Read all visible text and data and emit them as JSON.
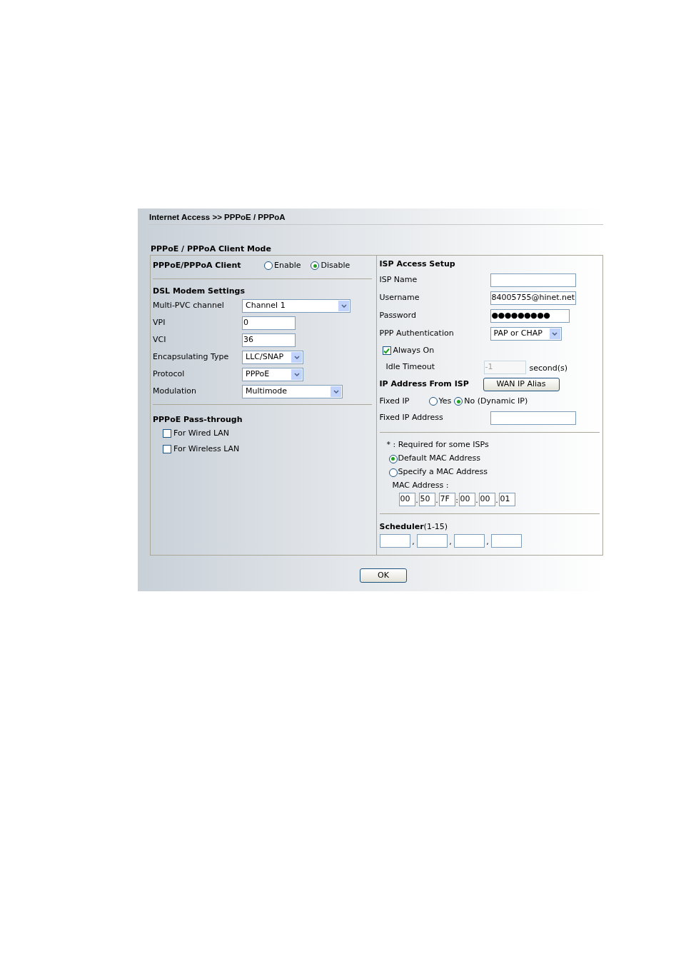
{
  "breadcrumb": "Internet Access >> PPPoE / PPPoA",
  "section_title": "PPPoE / PPPoA Client Mode",
  "client": {
    "label": "PPPoE/PPPoA Client",
    "options": [
      {
        "label": "Enable",
        "selected": false
      },
      {
        "label": "Disable",
        "selected": true
      }
    ]
  },
  "dsl": {
    "title": "DSL Modem Settings",
    "fields": [
      {
        "kind": "select",
        "label": "Multi-PVC channel",
        "value": "Channel 1"
      },
      {
        "kind": "text",
        "label": "VPI",
        "value": "0"
      },
      {
        "kind": "text",
        "label": "VCI",
        "value": "36"
      },
      {
        "kind": "select",
        "label": "Encapsulating Type",
        "value": "LLC/SNAP"
      },
      {
        "kind": "select",
        "label": "Protocol",
        "value": "PPPoE"
      },
      {
        "kind": "select",
        "label": "Modulation",
        "value": "Multimode"
      }
    ]
  },
  "pass_through": {
    "title": "PPPoE Pass-through",
    "options": [
      {
        "label": "For Wired LAN",
        "checked": false
      },
      {
        "label": "For Wireless LAN",
        "checked": false
      }
    ]
  },
  "isp": {
    "title": "ISP Access Setup",
    "fields": [
      {
        "kind": "text",
        "label": "ISP Name"
      },
      {
        "kind": "text",
        "label": "Username",
        "value": "84005755@hinet.net"
      },
      {
        "kind": "password",
        "label": "Password",
        "value": "●●●●●●●●●"
      },
      {
        "kind": "select",
        "label": "PPP Authentication",
        "value": "PAP or CHAP"
      }
    ]
  },
  "always_on": {
    "label": "Always On",
    "checked": true
  },
  "idle_timeout": {
    "label": "Idle Timeout",
    "value": "-1",
    "disabled": true,
    "unit": "second(s)"
  },
  "ip_from_isp": {
    "title": "IP Address From ISP",
    "button": "WAN IP Alias"
  },
  "fixed_ip": {
    "label": "Fixed IP",
    "options": [
      {
        "label": "Yes",
        "selected": false
      },
      {
        "label": "No (Dynamic IP)",
        "selected": true
      }
    ]
  },
  "fixed_ip_address": {
    "label": "Fixed IP Address"
  },
  "mac": {
    "note": "* : Required for some ISPs",
    "options": [
      {
        "label": "Default MAC Address",
        "selected": true
      },
      {
        "label": "Specify a MAC Address",
        "selected": false
      }
    ],
    "label": "MAC Address :",
    "octets": [
      "00",
      "50",
      "7F",
      "00",
      "00",
      "01"
    ],
    "separators": [
      ".",
      ".",
      ":",
      ".",
      "."
    ]
  },
  "scheduler": {
    "title": "Scheduler",
    "range": "(1-15)",
    "separators": [
      ",",
      ",",
      ","
    ]
  },
  "ok_button": "OK"
}
